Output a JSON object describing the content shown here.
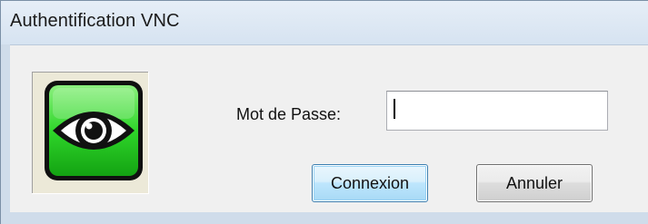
{
  "window": {
    "title": "Authentification VNC"
  },
  "logo": {
    "icon": "vnc-eye-icon",
    "color": "#2fd62a"
  },
  "form": {
    "password_label": "Mot de Passe:",
    "password_value": ""
  },
  "buttons": {
    "connect_label": "Connexion",
    "cancel_label": "Annuler"
  }
}
